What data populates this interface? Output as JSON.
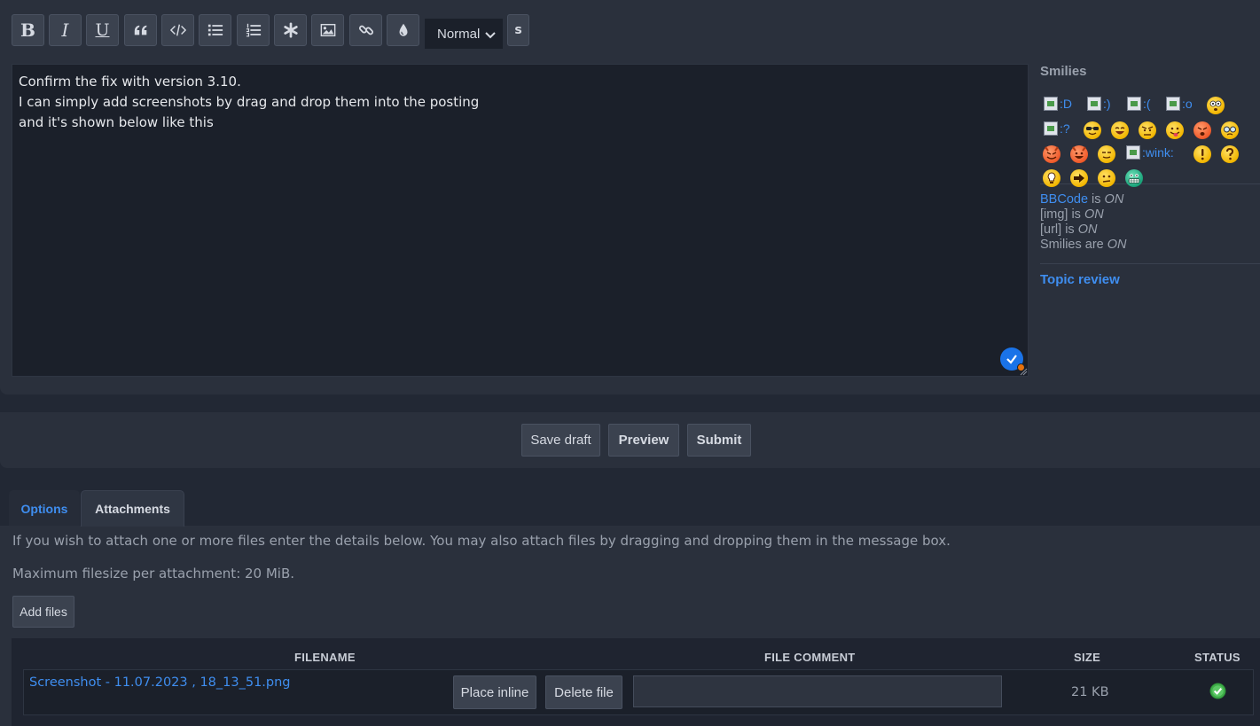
{
  "toolbar": {
    "buttons": [
      {
        "name": "bold",
        "label": "B"
      },
      {
        "name": "italic",
        "label": "I"
      },
      {
        "name": "underline",
        "label": "U"
      }
    ],
    "font_size": "Normal",
    "strike_label": "s"
  },
  "message": {
    "lines": [
      "Confirm the fix with version 3.10.",
      "I can simply add screenshots by drag and drop them into the posting",
      "and it's shown below like this"
    ]
  },
  "side": {
    "smilies_title": "Smilies",
    "broken_smilies": [
      ":D",
      ":)",
      ":(",
      ":o",
      ":?",
      ":wink:"
    ],
    "bbcode_label": "BBCode",
    "bbcode_state_prefix": " is ",
    "bbcode_state": "ON",
    "img_label": "[img] is ",
    "img_state": "ON",
    "url_label": "[url] is ",
    "url_state": "ON",
    "smilies_label": "Smilies are ",
    "smilies_state": "ON",
    "topic_review": "Topic review"
  },
  "actions": {
    "save_draft": "Save draft",
    "preview": "Preview",
    "submit": "Submit"
  },
  "tabs": {
    "options": "Options",
    "attachments": "Attachments"
  },
  "attachments": {
    "info": "If you wish to attach one or more files enter the details below. You may also attach files by dragging and dropping them in the message box.",
    "max_size": "Maximum filesize per attachment: 20 MiB.",
    "add_files": "Add files",
    "columns": {
      "filename": "FILENAME",
      "comment": "FILE COMMENT",
      "size": "SIZE",
      "status": "STATUS"
    },
    "rows": [
      {
        "filename": "Screenshot - 11.07.2023 , 18_13_51.png",
        "place_inline": "Place inline",
        "delete_file": "Delete file",
        "comment": "",
        "size": "21 KB",
        "status_icon": "check-circle-icon",
        "status_color": "#3fae49"
      }
    ]
  },
  "colors": {
    "accent_link": "#3f8ef0",
    "panel": "#2a303c",
    "background": "#222834"
  }
}
